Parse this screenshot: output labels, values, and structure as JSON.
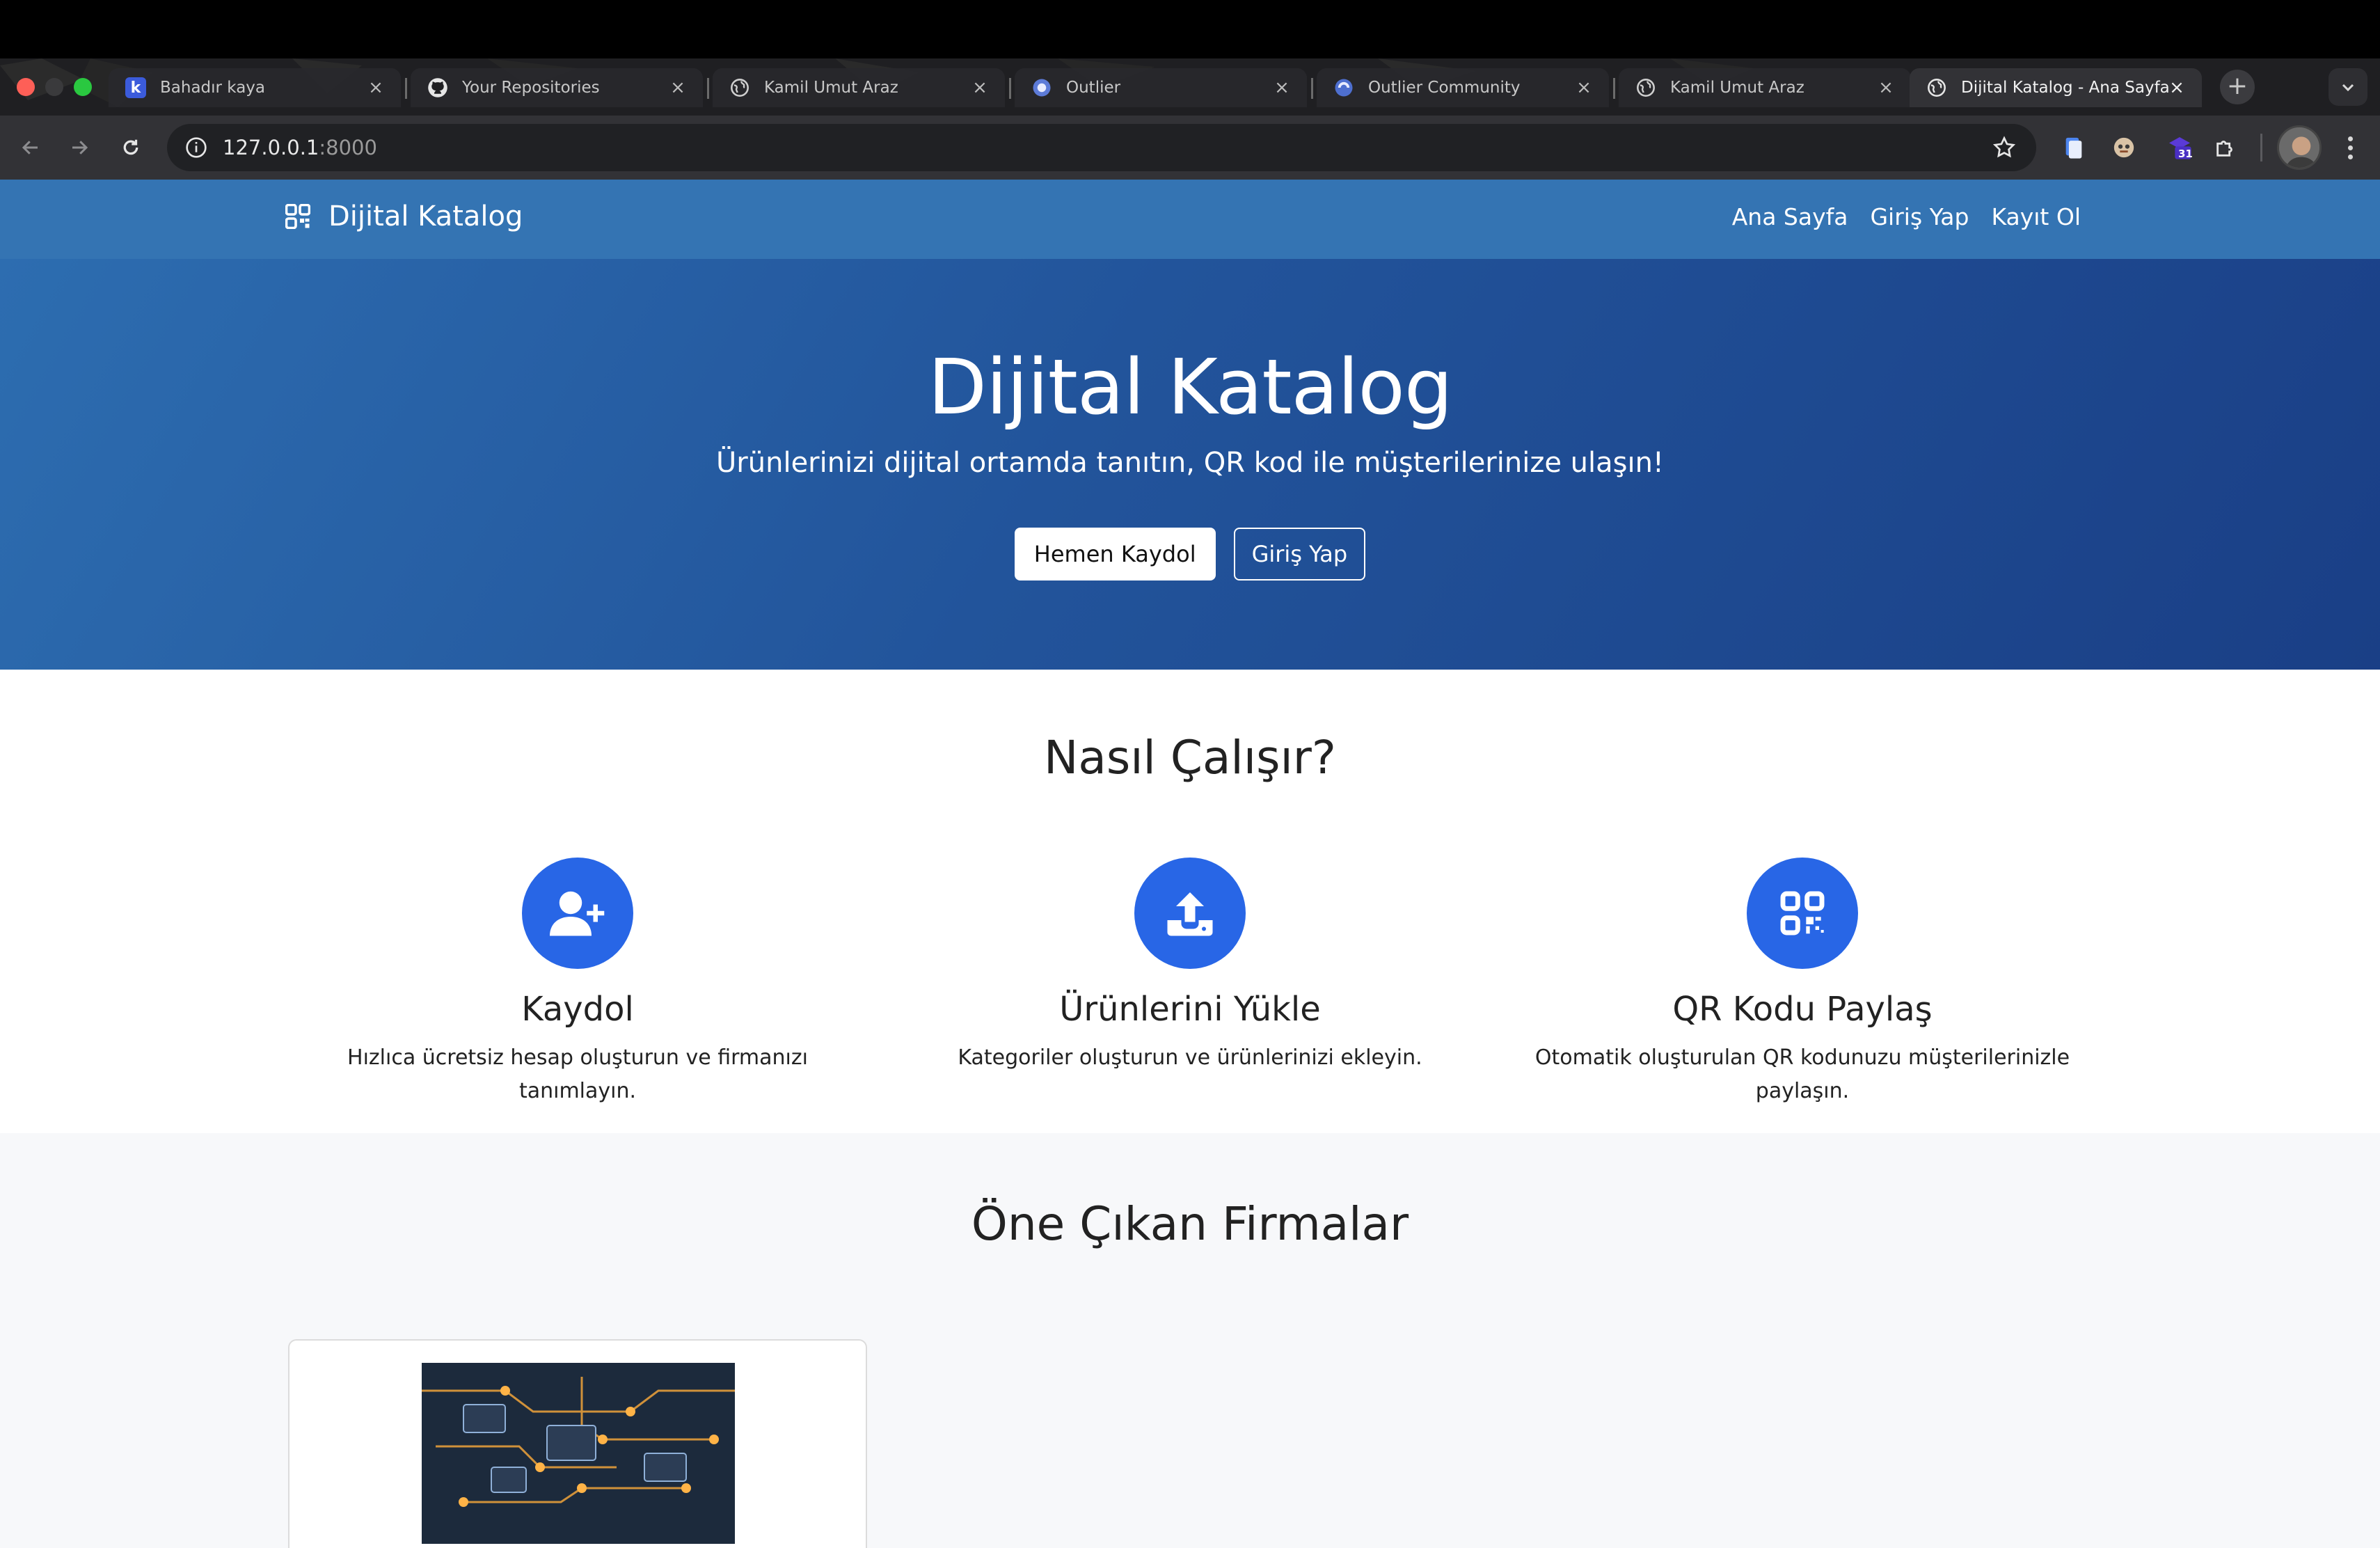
{
  "browser": {
    "tabs": [
      {
        "title": "Bahadır kaya",
        "icon": "k-app-icon"
      },
      {
        "title": "Your Repositories",
        "icon": "github-icon"
      },
      {
        "title": "Kamil Umut Araz",
        "icon": "globe-icon"
      },
      {
        "title": "Outlier",
        "icon": "outlier-icon"
      },
      {
        "title": "Outlier Community",
        "icon": "outlier-icon"
      },
      {
        "title": "Kamil Umut Araz",
        "icon": "globe-icon"
      },
      {
        "title": "Dijital Katalog - Ana Sayfa",
        "icon": "globe-icon",
        "active": true
      }
    ],
    "url_host": "127.0.0.1",
    "url_port": ":8000",
    "calendar_badge": "31"
  },
  "site": {
    "brand": "Dijital Katalog",
    "nav": {
      "home": "Ana Sayfa",
      "login": "Giriş Yap",
      "register": "Kayıt Ol"
    },
    "hero": {
      "title": "Dijital Katalog",
      "subtitle": "Ürünlerinizi dijital ortamda tanıtın, QR kod ile müşterilerinize ulaşın!",
      "primary_button": "Hemen Kaydol",
      "secondary_button": "Giriş Yap"
    },
    "how": {
      "title": "Nasıl Çalışır?",
      "steps": [
        {
          "title": "Kaydol",
          "text": "Hızlıca ücretsiz hesap oluşturun ve firmanızı tanımlayın.",
          "icon": "user-plus-icon"
        },
        {
          "title": "Ürünlerini Yükle",
          "text": "Kategoriler oluşturun ve ürünlerinizi ekleyin.",
          "icon": "upload-icon"
        },
        {
          "title": "QR Kodu Paylaş",
          "text": "Otomatik oluşturulan QR kodunuzu müşterilerinizle paylaşın.",
          "icon": "qr-code-icon"
        }
      ]
    },
    "featured": {
      "title": "Öne Çıkan Firmalar"
    }
  },
  "colors": {
    "nav_bg": "#3474b3",
    "hero_start": "#2d6db0",
    "hero_end": "#1a3f86",
    "accent_blue": "#2866e6",
    "featured_bg": "#f7f8fa"
  }
}
